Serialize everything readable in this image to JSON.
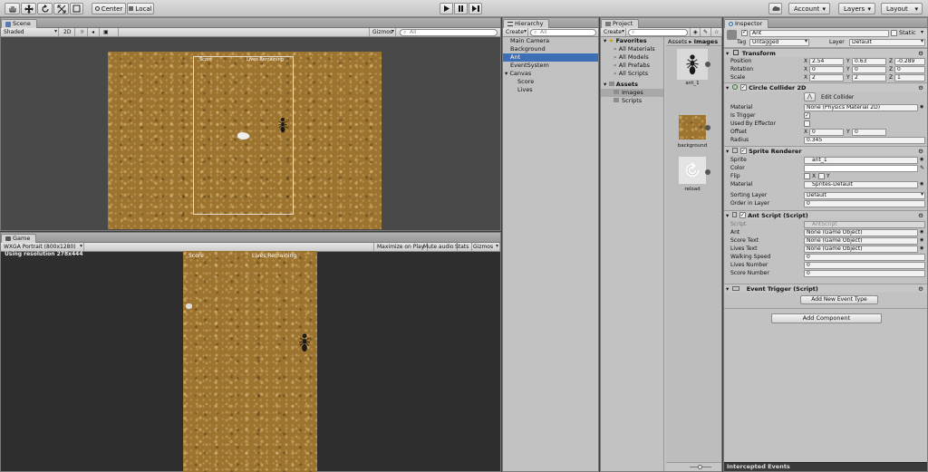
{
  "toolbar": {
    "pivot_label": "Center",
    "space_label": "Local",
    "account_label": "Account",
    "layers_label": "Layers",
    "layout_label": "Layout"
  },
  "scene": {
    "tab_label": "Scene",
    "shading": "Shaded",
    "mode_2d": "2D",
    "gizmos": "Gizmos",
    "search_placeholder": "All",
    "hud_score": "Score",
    "hud_lives": "Lives Remaining"
  },
  "game": {
    "tab_label": "Game",
    "aspect": "WXGA Portrait (800x1280)",
    "maximize": "Maximize on Play",
    "mute": "Mute audio",
    "stats": "Stats",
    "gizmos": "Gizmos",
    "resolution_note": "Using resolution 278x444",
    "hud_score": "Score",
    "hud_lives": "Lives Remaining"
  },
  "hierarchy": {
    "tab_label": "Hierarchy",
    "create_label": "Create",
    "search_placeholder": "All",
    "items": [
      {
        "label": "Main Camera",
        "indent": 0
      },
      {
        "label": "Background",
        "indent": 0
      },
      {
        "label": "Ant",
        "indent": 0,
        "selected": true
      },
      {
        "label": "EventSystem",
        "indent": 0
      },
      {
        "label": "Canvas",
        "indent": 0,
        "foldout": true
      },
      {
        "label": "Score",
        "indent": 1
      },
      {
        "label": "Lives",
        "indent": 1
      }
    ]
  },
  "project": {
    "tab_label": "Project",
    "create_label": "Create",
    "favorites_label": "Favorites",
    "favorites": [
      "All Materials",
      "All Models",
      "All Prefabs",
      "All Scripts"
    ],
    "assets_label": "Assets",
    "folders": [
      "Images",
      "Scripts"
    ],
    "breadcrumb_root": "Assets",
    "breadcrumb_sep": "▸",
    "breadcrumb_current": "Images",
    "assets": [
      "ant_1",
      "background",
      "reload"
    ]
  },
  "inspector": {
    "tab_label": "Inspector",
    "object_name": "Ant",
    "static_label": "Static",
    "tag_label": "Tag",
    "tag_value": "Untagged",
    "layer_label": "Layer",
    "layer_value": "Default",
    "transform": {
      "title": "Transform",
      "position_label": "Position",
      "rotation_label": "Rotation",
      "scale_label": "Scale",
      "position": [
        "2.54",
        "0.63",
        "-0.289"
      ],
      "rotation": [
        "0",
        "0",
        "0"
      ],
      "scale": [
        "2",
        "2",
        "1"
      ]
    },
    "collider": {
      "title": "Circle Collider 2D",
      "edit_label": "Edit Collider",
      "material_label": "Material",
      "material_value": "None (Physics Material 2D)",
      "trigger_label": "Is Trigger",
      "effector_label": "Used By Effector",
      "offset_label": "Offset",
      "offset": [
        "0",
        "0"
      ],
      "radius_label": "Radius",
      "radius_value": "0.345"
    },
    "sprite": {
      "title": "Sprite Renderer",
      "sprite_label": "Sprite",
      "sprite_value": "ant_1",
      "color_label": "Color",
      "flip_label": "Flip",
      "material_label": "Material",
      "material_value": "Sprites-Default",
      "sorting_label": "Sorting Layer",
      "sorting_value": "Default",
      "order_label": "Order in Layer",
      "order_value": "0"
    },
    "ant_script": {
      "title": "Ant Script (Script)",
      "script_label": "Script",
      "script_value": "AntScript",
      "ant_label": "Ant",
      "ant_value": "None (Game Object)",
      "score_text_label": "Score Text",
      "score_text_value": "None (Game Object)",
      "lives_text_label": "Lives Text",
      "lives_text_value": "None (Game Object)",
      "walk_label": "Walking Speed",
      "walk_value": "0",
      "lives_label": "Lives Number",
      "lives_value": "0",
      "score_label": "Score Number",
      "score_value": "0"
    },
    "event_trigger": {
      "title": "Event Trigger (Script)",
      "add_event_label": "Add New Event Type"
    },
    "add_component_label": "Add Component",
    "intercepted_label": "Intercepted Events"
  },
  "colors": {
    "selection": "#3d6fb4",
    "panel_bg": "#c2c2c2",
    "dirt": "#9c7430",
    "dark_bg": "#2e2e2e"
  }
}
